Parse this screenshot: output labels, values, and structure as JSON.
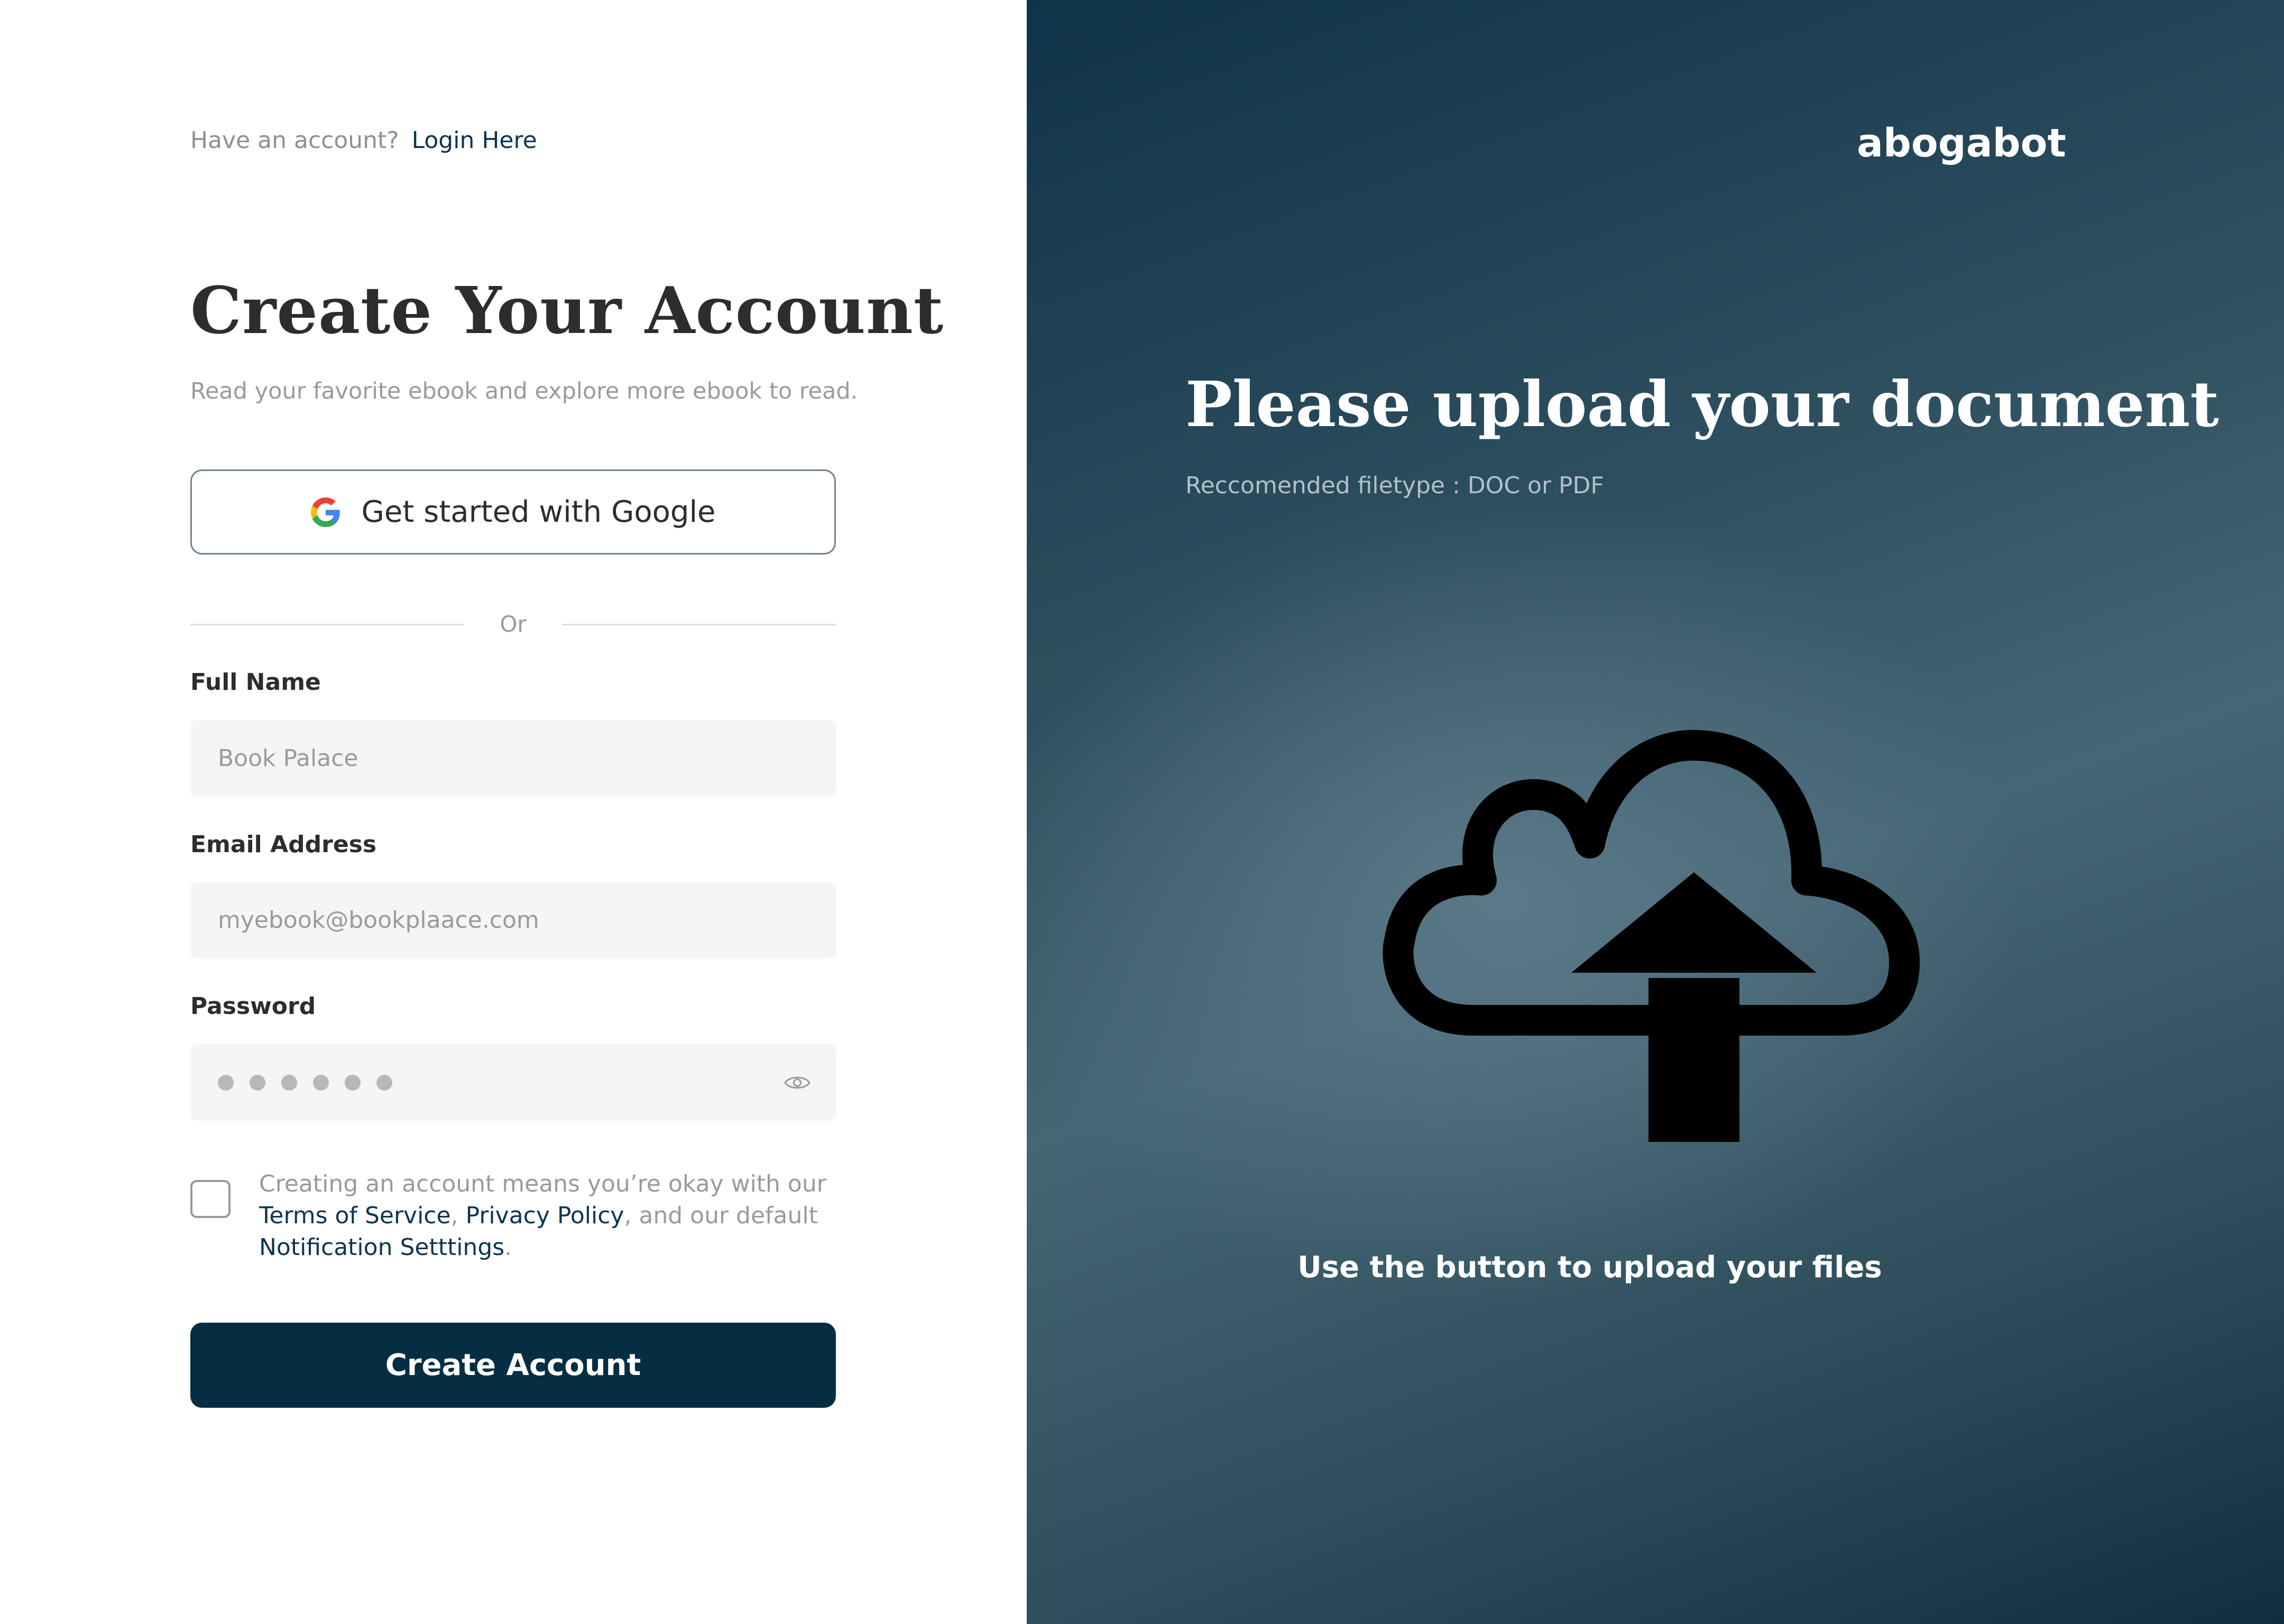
{
  "auth": {
    "have_account_text": "Have an account?",
    "login_link": "Login Here",
    "title": "Create Your Account",
    "subtitle": "Read your favorite ebook and explore more ebook to read.",
    "google_button": "Get started with Google",
    "divider_text": "Or",
    "full_name": {
      "label": "Full Name",
      "placeholder": "Book Palace"
    },
    "email": {
      "label": "Email Address",
      "placeholder": "myebook@bookplaace.com"
    },
    "password": {
      "label": "Password",
      "masked_length": 6,
      "toggle_icon": "eye-icon"
    },
    "terms": {
      "checked": false,
      "prefix": "Creating an account means you’re okay with our",
      "tos_link": "Terms of Service",
      "sep1": ",",
      "privacy_link": "Privacy Policy",
      "middle": ", and our default",
      "notification_link": "Notification Setttings",
      "suffix": "."
    },
    "create_button": "Create Account"
  },
  "upload": {
    "brand": "abogabot",
    "title": "Please upload your document",
    "filetype_note": "Reccomended filetype : DOC or PDF",
    "icon": "cloud-upload-icon",
    "hint": "Use the button to upload your files"
  },
  "colors": {
    "primary": "#052e43",
    "link": "#0a3550",
    "muted_text": "#9a9a9a",
    "field_bg": "#f5f5f5"
  }
}
